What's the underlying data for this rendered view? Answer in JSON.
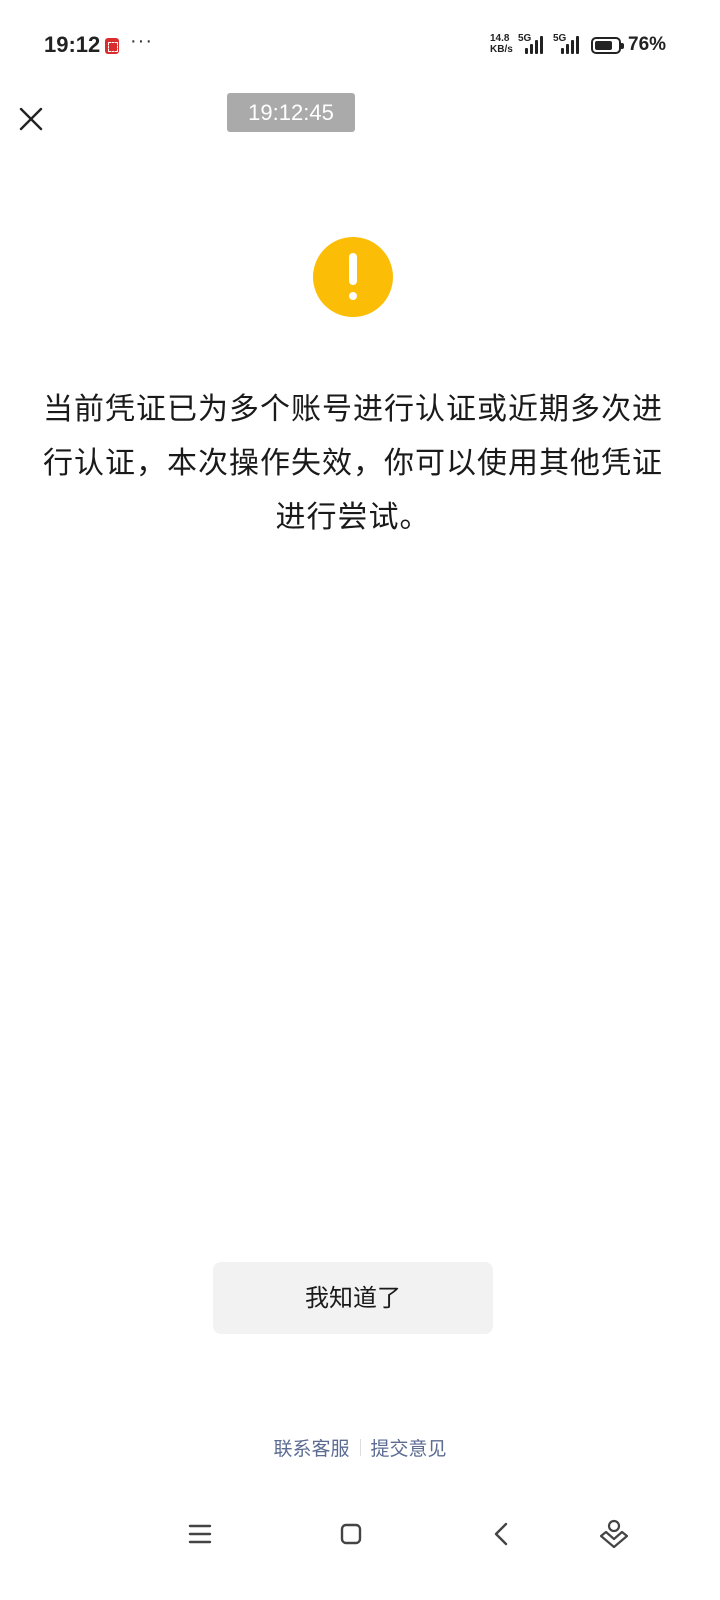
{
  "status_bar": {
    "time": "19:12",
    "more": "···",
    "net_speed_value": "14.8",
    "net_speed_unit": "KB/s",
    "signal1_label": "5G",
    "signal2_label": "5G",
    "battery_percent": "76%",
    "battery_level": 0.76
  },
  "header": {
    "timestamp": "19:12:45"
  },
  "warning": {
    "icon": "exclamation-circle-icon",
    "color": "#fbbd05",
    "message": "当前凭证已为多个账号进行认证或近期多次进行认证，本次操作失效，你可以使用其他凭证进行尝试。"
  },
  "actions": {
    "confirm_label": "我知道了"
  },
  "footer": {
    "contact_label": "联系客服",
    "feedback_label": "提交意见",
    "link_color": "#5b6b91"
  },
  "nav_bar": {
    "items": [
      "menu-icon",
      "home-square-icon",
      "back-chevron-icon",
      "assistant-icon"
    ]
  }
}
